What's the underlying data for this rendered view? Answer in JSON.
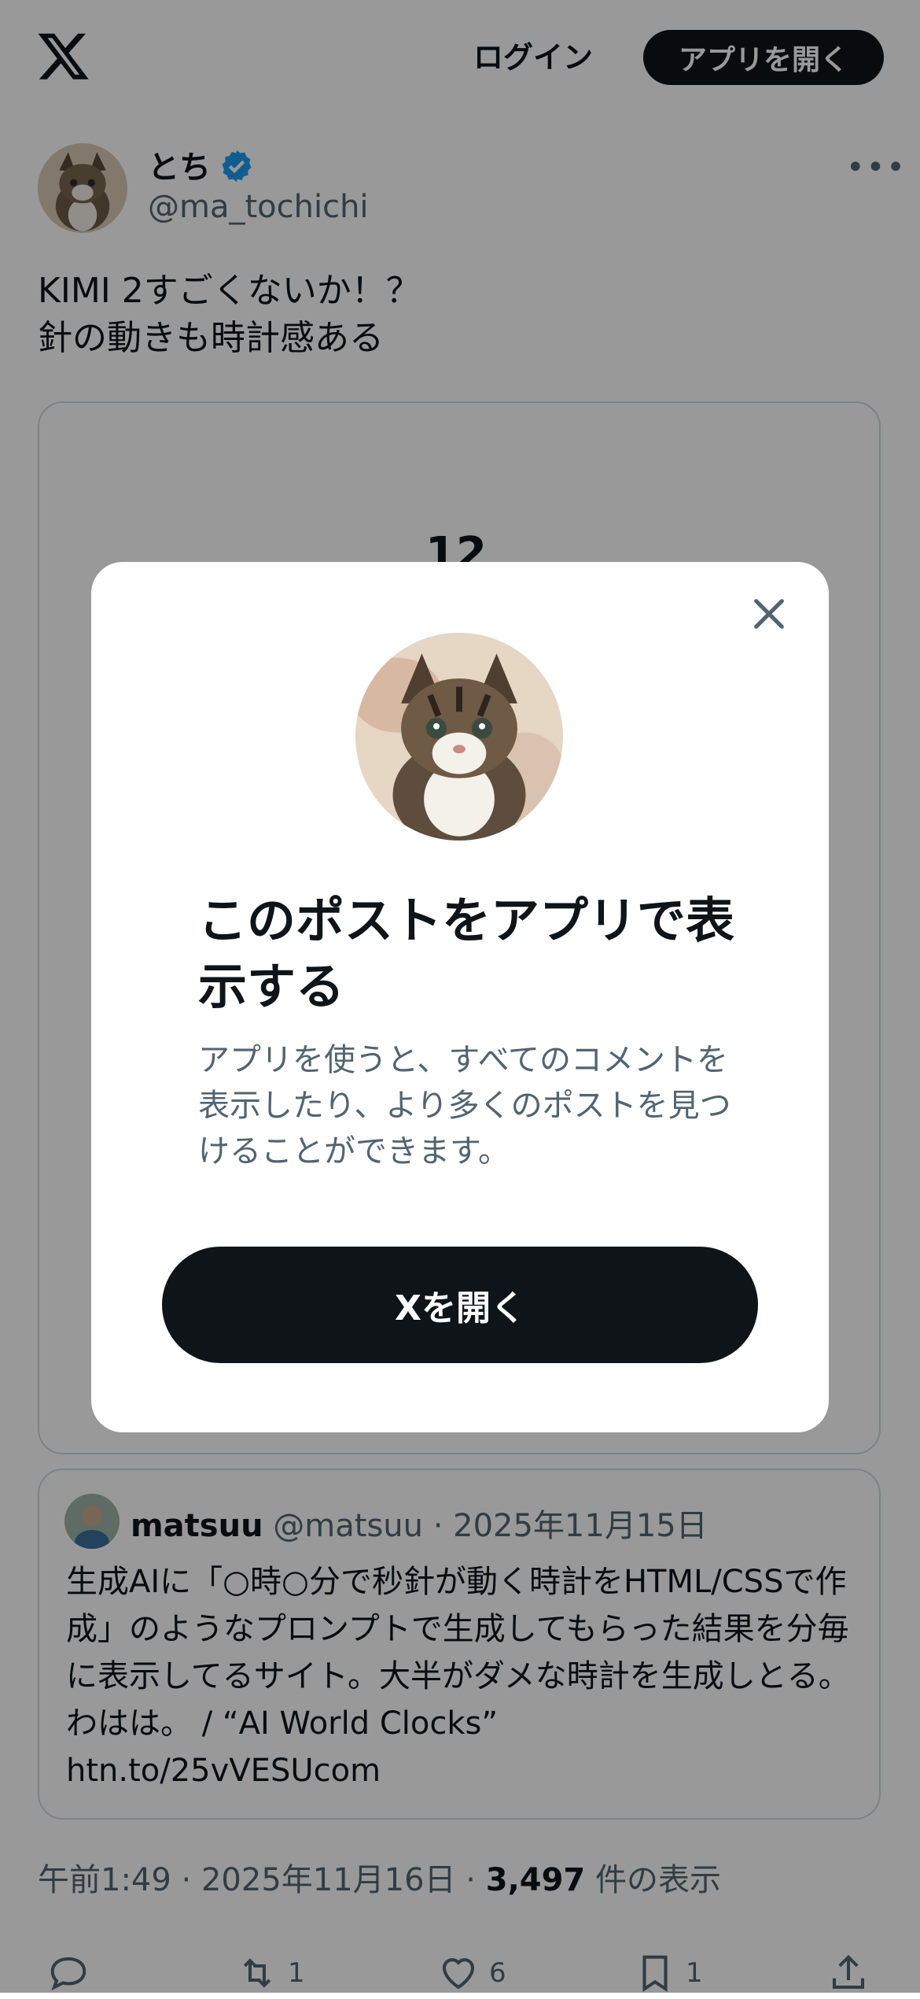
{
  "header": {
    "logo_icon": "x-logo-icon",
    "login_label": "ログイン",
    "open_app_label": "アプリを開く"
  },
  "post": {
    "author_name": "とち",
    "verified_icon": "verified-badge-icon",
    "author_handle": "@ma_tochichi",
    "more_icon": "more-icon",
    "text": "KIMI 2すごくないか！？\n針の動きも時計感ある",
    "media_text": "12",
    "quote": {
      "name": "matsuu",
      "handle": "@matsuu",
      "separator": "·",
      "date": "2025年11月15日",
      "text": "生成AIに「○時○分で秒針が動く時計をHTML/CSSで作成」のようなプロンプトで生成してもらった結果を分毎に表示してるサイト。大半がダメな時計を生成しとる。わはは。 / “AI World Clocks”",
      "link": "htn.to/25vVESUcom"
    },
    "meta": {
      "time": "午前1:49",
      "separator": "·",
      "date": "2025年11月16日",
      "views_count": "3,497",
      "views_label": "件の表示"
    },
    "actions": {
      "reply_icon": "reply-icon",
      "repost_icon": "repost-icon",
      "repost_count": "1",
      "like_icon": "heart-icon",
      "like_count": "6",
      "bookmark_icon": "bookmark-icon",
      "bookmark_count": "1",
      "share_icon": "share-icon"
    }
  },
  "modal": {
    "close_icon": "close-icon",
    "title": "このポストをアプリで表示する",
    "description": "アプリを使うと、すべてのコメントを表示したり、より多くのポストを見つけることができます。",
    "button_label": "Xを開く"
  },
  "colors": {
    "primary_text": "#0f1419",
    "secondary_text": "#536471",
    "border": "#cfd9de",
    "verified": "#1d9bf0",
    "overlay": "rgba(0,0,0,0.40)"
  }
}
